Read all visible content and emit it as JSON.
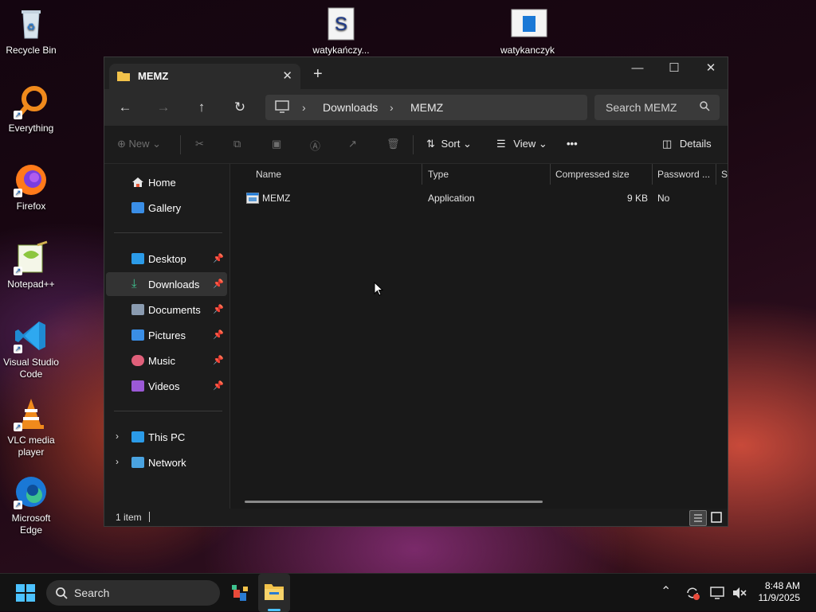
{
  "desktop": {
    "icons": [
      {
        "label": "Recycle Bin"
      },
      {
        "label": "Everything"
      },
      {
        "label": "Firefox"
      },
      {
        "label": "Notepad++"
      },
      {
        "label": "Visual Studio Code"
      },
      {
        "label": "VLC media player"
      },
      {
        "label": "Microsoft Edge"
      },
      {
        "label": "watykańczy..."
      },
      {
        "label": "watykanczyk"
      }
    ]
  },
  "window": {
    "tab_title": "MEMZ",
    "new_tab_icon": "+",
    "close_tab_icon": "✕",
    "controls": {
      "minimize": "—",
      "maximize": "☐",
      "close": "✕"
    }
  },
  "address": {
    "breadcrumbs": [
      "Downloads",
      "MEMZ"
    ],
    "search_placeholder": "Search MEMZ"
  },
  "toolbar": {
    "new_label": "New",
    "sort_label": "Sort",
    "view_label": "View",
    "details_label": "Details"
  },
  "sidebar": {
    "home": "Home",
    "gallery": "Gallery",
    "quick_access": [
      {
        "label": "Desktop",
        "color": "#2b9be8"
      },
      {
        "label": "Downloads",
        "color": "#3ec28f"
      },
      {
        "label": "Documents",
        "color": "#8a9bb0"
      },
      {
        "label": "Pictures",
        "color": "#3a8ee6"
      },
      {
        "label": "Music",
        "color": "#e0607a"
      },
      {
        "label": "Videos",
        "color": "#9b59d6"
      }
    ],
    "this_pc": "This PC",
    "network": "Network"
  },
  "file_list": {
    "columns": [
      "Name",
      "Type",
      "Compressed size",
      "Password ...",
      "Si"
    ],
    "rows": [
      {
        "name": "MEMZ",
        "type": "Application",
        "compressed_size": "9 KB",
        "password": "No"
      }
    ]
  },
  "status": {
    "item_count": "1 item"
  },
  "taskbar": {
    "search_label": "Search",
    "time": "8:48 AM",
    "date": "11/9/2025"
  }
}
